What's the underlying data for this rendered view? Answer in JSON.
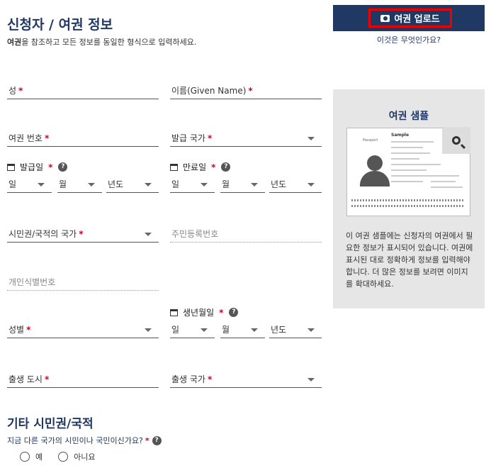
{
  "header": {
    "title": "신청자 / 여권 정보",
    "subtitle_bold": "여권",
    "subtitle_rest": "을 참조하고 모든 정보를 동일한 형식으로 입력하세요."
  },
  "upload": {
    "label": "여권 업로드",
    "help_link": "이것은 무엇인가요?"
  },
  "sample": {
    "title": "여권 샘플",
    "doc_sample_word": "Sample",
    "doc_passport_word": "Passport",
    "description": "이 여권 샘플에는 신청자의 여권에서 필요한 정보가 표시되어 있습니다. 여권에 표시된 대로 정확하게 정보를 입력해야 합니다. 더 많은 정보를 보려면 이미지를 확대하세요."
  },
  "fields": {
    "surname": "성",
    "given_name": "이름(Given Name)",
    "passport_number": "여권 번호",
    "issuing_country": "발급 국가",
    "issue_date": "발급일",
    "expiry_date": "만료일",
    "citizenship_country": "시민권/국적의 국가",
    "national_id": "주민등록번호",
    "personal_id": "개인식별번호",
    "birth_date": "생년월일",
    "gender": "성별",
    "birth_city": "출생 도시",
    "birth_country": "출생 국가",
    "required_mark": "*",
    "help_mark": "?"
  },
  "date_parts": {
    "day": "일",
    "month": "월",
    "year": "년도"
  },
  "other_citizenship": {
    "title": "기타 시민권/국적",
    "question": "지금 다른 국가의 시민이나 국민이신가요?",
    "options": [
      "예",
      "아니요"
    ]
  }
}
